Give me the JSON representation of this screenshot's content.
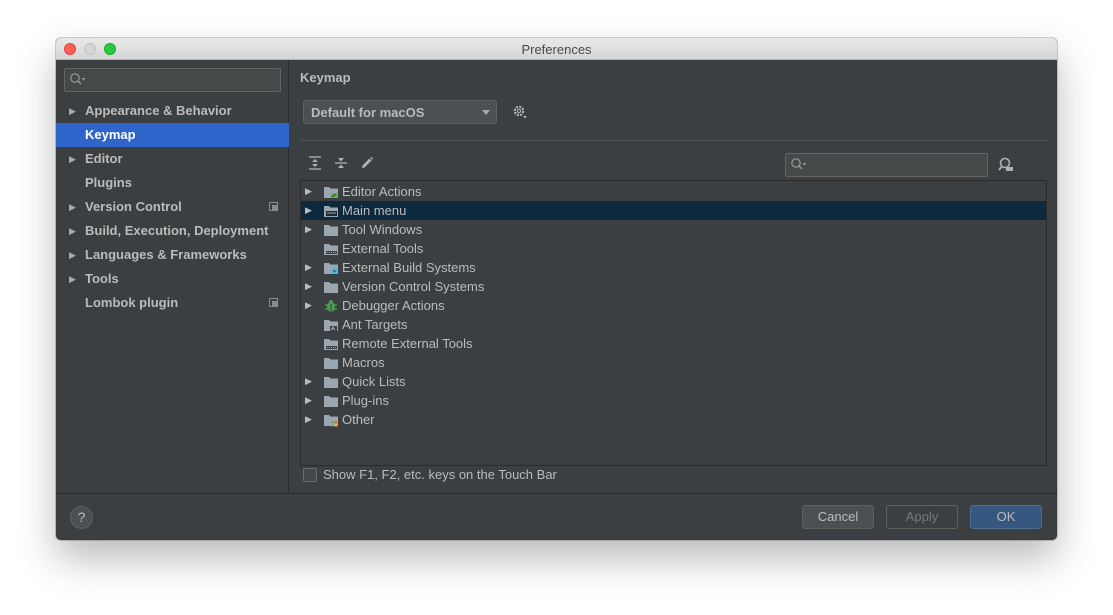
{
  "window": {
    "title": "Preferences"
  },
  "sidebar": {
    "search_placeholder": "",
    "items": [
      {
        "label": "Appearance & Behavior",
        "expandable": true,
        "selected": false,
        "project_scoped": false
      },
      {
        "label": "Keymap",
        "expandable": false,
        "selected": true,
        "project_scoped": false
      },
      {
        "label": "Editor",
        "expandable": true,
        "selected": false,
        "project_scoped": false
      },
      {
        "label": "Plugins",
        "expandable": false,
        "selected": false,
        "project_scoped": false
      },
      {
        "label": "Version Control",
        "expandable": true,
        "selected": false,
        "project_scoped": true
      },
      {
        "label": "Build, Execution, Deployment",
        "expandable": true,
        "selected": false,
        "project_scoped": false
      },
      {
        "label": "Languages & Frameworks",
        "expandable": true,
        "selected": false,
        "project_scoped": false
      },
      {
        "label": "Tools",
        "expandable": true,
        "selected": false,
        "project_scoped": false
      },
      {
        "label": "Lombok plugin",
        "expandable": false,
        "selected": false,
        "project_scoped": true
      }
    ]
  },
  "main": {
    "title": "Keymap",
    "keymap_select": {
      "value": "Default for macOS"
    },
    "filter_placeholder": "",
    "tree": [
      {
        "label": "Editor Actions",
        "expandable": true,
        "icon": "folder-editor-icon",
        "selected": false
      },
      {
        "label": "Main menu",
        "expandable": true,
        "icon": "folder-menu-icon",
        "selected": true
      },
      {
        "label": "Tool Windows",
        "expandable": true,
        "icon": "folder-icon",
        "selected": false
      },
      {
        "label": "External Tools",
        "expandable": false,
        "icon": "folder-tools-icon",
        "selected": false
      },
      {
        "label": "External Build Systems",
        "expandable": true,
        "icon": "folder-build-icon",
        "selected": false
      },
      {
        "label": "Version Control Systems",
        "expandable": true,
        "icon": "folder-icon",
        "selected": false
      },
      {
        "label": "Debugger Actions",
        "expandable": true,
        "icon": "bug-icon",
        "selected": false
      },
      {
        "label": "Ant Targets",
        "expandable": false,
        "icon": "folder-ant-icon",
        "selected": false
      },
      {
        "label": "Remote External Tools",
        "expandable": false,
        "icon": "folder-tools-icon",
        "selected": false
      },
      {
        "label": "Macros",
        "expandable": false,
        "icon": "folder-icon",
        "selected": false
      },
      {
        "label": "Quick Lists",
        "expandable": true,
        "icon": "folder-icon",
        "selected": false
      },
      {
        "label": "Plug-ins",
        "expandable": true,
        "icon": "folder-icon",
        "selected": false
      },
      {
        "label": "Other",
        "expandable": true,
        "icon": "folder-other-icon",
        "selected": false
      }
    ],
    "touchbar_checkbox": {
      "label": "Show F1, F2, etc. keys on the Touch Bar",
      "checked": false
    }
  },
  "footer": {
    "help": "?",
    "cancel": "Cancel",
    "apply": "Apply",
    "ok": "OK"
  },
  "colors": {
    "background": "#3c3f41",
    "selection_sidebar": "#2f65ca",
    "selection_tree": "#0d293e",
    "ok_button": "#365880",
    "text": "#bbbbbb"
  }
}
